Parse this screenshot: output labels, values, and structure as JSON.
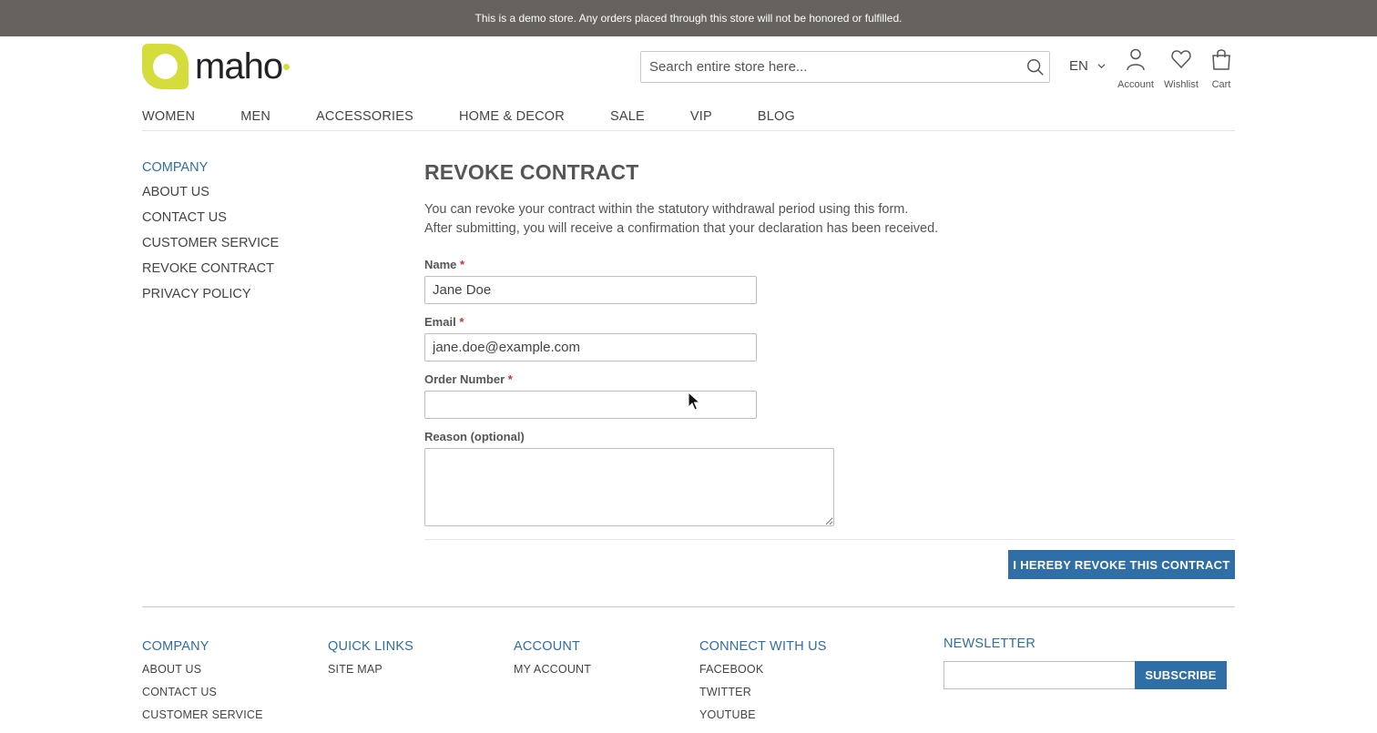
{
  "demo_notice": "This is a demo store. Any orders placed through this store will not be honored or fulfilled.",
  "header": {
    "logo_text": "maho",
    "search_placeholder": "Search entire store here...",
    "language": "EN",
    "account_label": "Account",
    "wishlist_label": "Wishlist",
    "cart_label": "Cart"
  },
  "nav": [
    "WOMEN",
    "MEN",
    "ACCESSORIES",
    "HOME & DECOR",
    "SALE",
    "VIP",
    "BLOG"
  ],
  "sidebar": {
    "title": "COMPANY",
    "items": [
      "ABOUT US",
      "CONTACT US",
      "CUSTOMER SERVICE",
      "REVOKE CONTRACT",
      "PRIVACY POLICY"
    ]
  },
  "main": {
    "title": "REVOKE CONTRACT",
    "intro_line1": "You can revoke your contract within the statutory withdrawal period using this form.",
    "intro_line2": "After submitting, you will receive a confirmation that your declaration has been received.",
    "fields": {
      "name_label": "Name",
      "name_value": "Jane Doe",
      "email_label": "Email",
      "email_value": "jane.doe@example.com",
      "order_label": "Order Number",
      "order_value": "",
      "reason_label": "Reason (optional)",
      "reason_value": "",
      "required_mark": "*"
    },
    "submit_label": "I HEREBY REVOKE THIS CONTRACT"
  },
  "footer": {
    "company": {
      "title": "COMPANY",
      "items": [
        "ABOUT US",
        "CONTACT US",
        "CUSTOMER SERVICE"
      ]
    },
    "quick_links": {
      "title": "QUICK LINKS",
      "items": [
        "SITE MAP"
      ]
    },
    "account": {
      "title": "ACCOUNT",
      "items": [
        "MY ACCOUNT"
      ]
    },
    "connect": {
      "title": "CONNECT WITH US",
      "items": [
        "FACEBOOK",
        "TWITTER",
        "YOUTUBE"
      ]
    },
    "newsletter": {
      "title": "NEWSLETTER",
      "subscribe_label": "SUBSCRIBE"
    }
  },
  "colors": {
    "accent": "#2f6ea6",
    "brand": "#d4dd3b",
    "demo_bar": "#66625e",
    "required": "#d0312d"
  }
}
